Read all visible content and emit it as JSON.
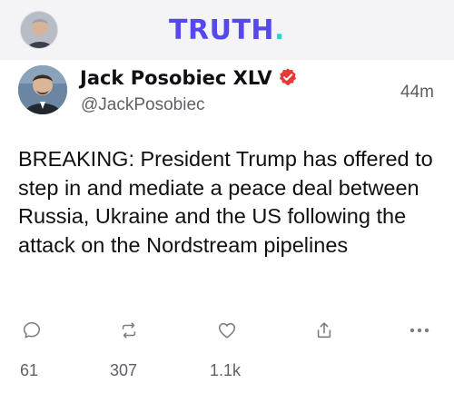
{
  "header": {
    "logo_text": "TRUTH",
    "logo_dot": ".",
    "logo_color": "#5448ee",
    "logo_dot_color": "#2fd3ce",
    "avatar_icon": "user-avatar"
  },
  "post": {
    "author": {
      "display_name": "Jack Posobiec XLV",
      "handle": "@JackPosobiec",
      "verified": true,
      "verified_color": "#e53935",
      "avatar_icon": "author-avatar"
    },
    "time": "44m",
    "text": "BREAKING: President Trump has offered to step in and mediate a peace deal between Russia, Ukraine and the US following the attack on the Nordstream pipelines"
  },
  "actions": {
    "reply": {
      "icon": "comment-icon",
      "count": "61"
    },
    "retruth": {
      "icon": "repost-icon",
      "count": "307"
    },
    "like": {
      "icon": "heart-icon",
      "count": "1.1k"
    },
    "share": {
      "icon": "share-icon"
    },
    "more": {
      "icon": "more-icon"
    }
  }
}
